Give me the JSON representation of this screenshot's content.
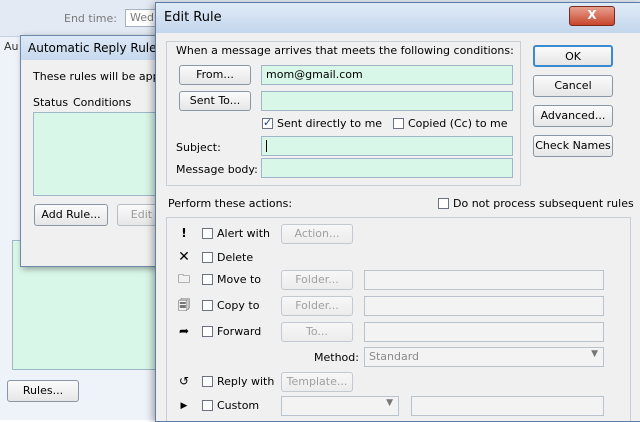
{
  "background_window": {
    "end_time_label": "End time:",
    "end_time_value": "Wed",
    "partial_label": "Au",
    "rules_button": "Rules..."
  },
  "auto_reply_rules": {
    "title": "Automatic Reply Rules",
    "description": "These rules will be applie",
    "columns": [
      "Status",
      "Conditions"
    ],
    "add_rule_button": "Add Rule...",
    "edit_rule_button": "Edit R"
  },
  "edit_rule": {
    "title": "Edit Rule",
    "close_label": "X",
    "conditions_label": "When a message arrives that meets the following conditions:",
    "from_button": "From...",
    "from_value": "mom@gmail.com",
    "sent_to_button": "Sent To...",
    "sent_to_value": "",
    "sent_directly_label": "Sent directly to me",
    "sent_directly_checked": true,
    "copied_label": "Copied (Cc) to me",
    "copied_checked": false,
    "subject_label": "Subject:",
    "subject_value": "",
    "body_label": "Message body:",
    "body_value": "",
    "buttons": {
      "ok": "OK",
      "cancel": "Cancel",
      "advanced": "Advanced...",
      "check_names": "Check Names"
    },
    "actions_label": "Perform these actions:",
    "do_not_process_label": "Do not process subsequent rules",
    "actions": {
      "alert_label": "Alert with",
      "alert_button": "Action...",
      "delete_label": "Delete",
      "move_label": "Move to",
      "move_button": "Folder...",
      "copy_label": "Copy to",
      "copy_button": "Folder...",
      "forward_label": "Forward",
      "forward_button": "To...",
      "method_label": "Method:",
      "method_value": "Standard",
      "reply_label": "Reply with",
      "reply_button": "Template...",
      "custom_label": "Custom"
    }
  },
  "colors": {
    "field_mint": "#d9f7e8",
    "titlebar": "#c7d9ee",
    "close_red": "#c8452c"
  },
  "icons": [
    "exclamation-icon",
    "delete-x-icon",
    "move-folder-icon",
    "copy-folder-icon",
    "forward-icon",
    "reply-icon",
    "custom-arrow-icon",
    "close-icon",
    "dropdown-arrow-icon"
  ]
}
